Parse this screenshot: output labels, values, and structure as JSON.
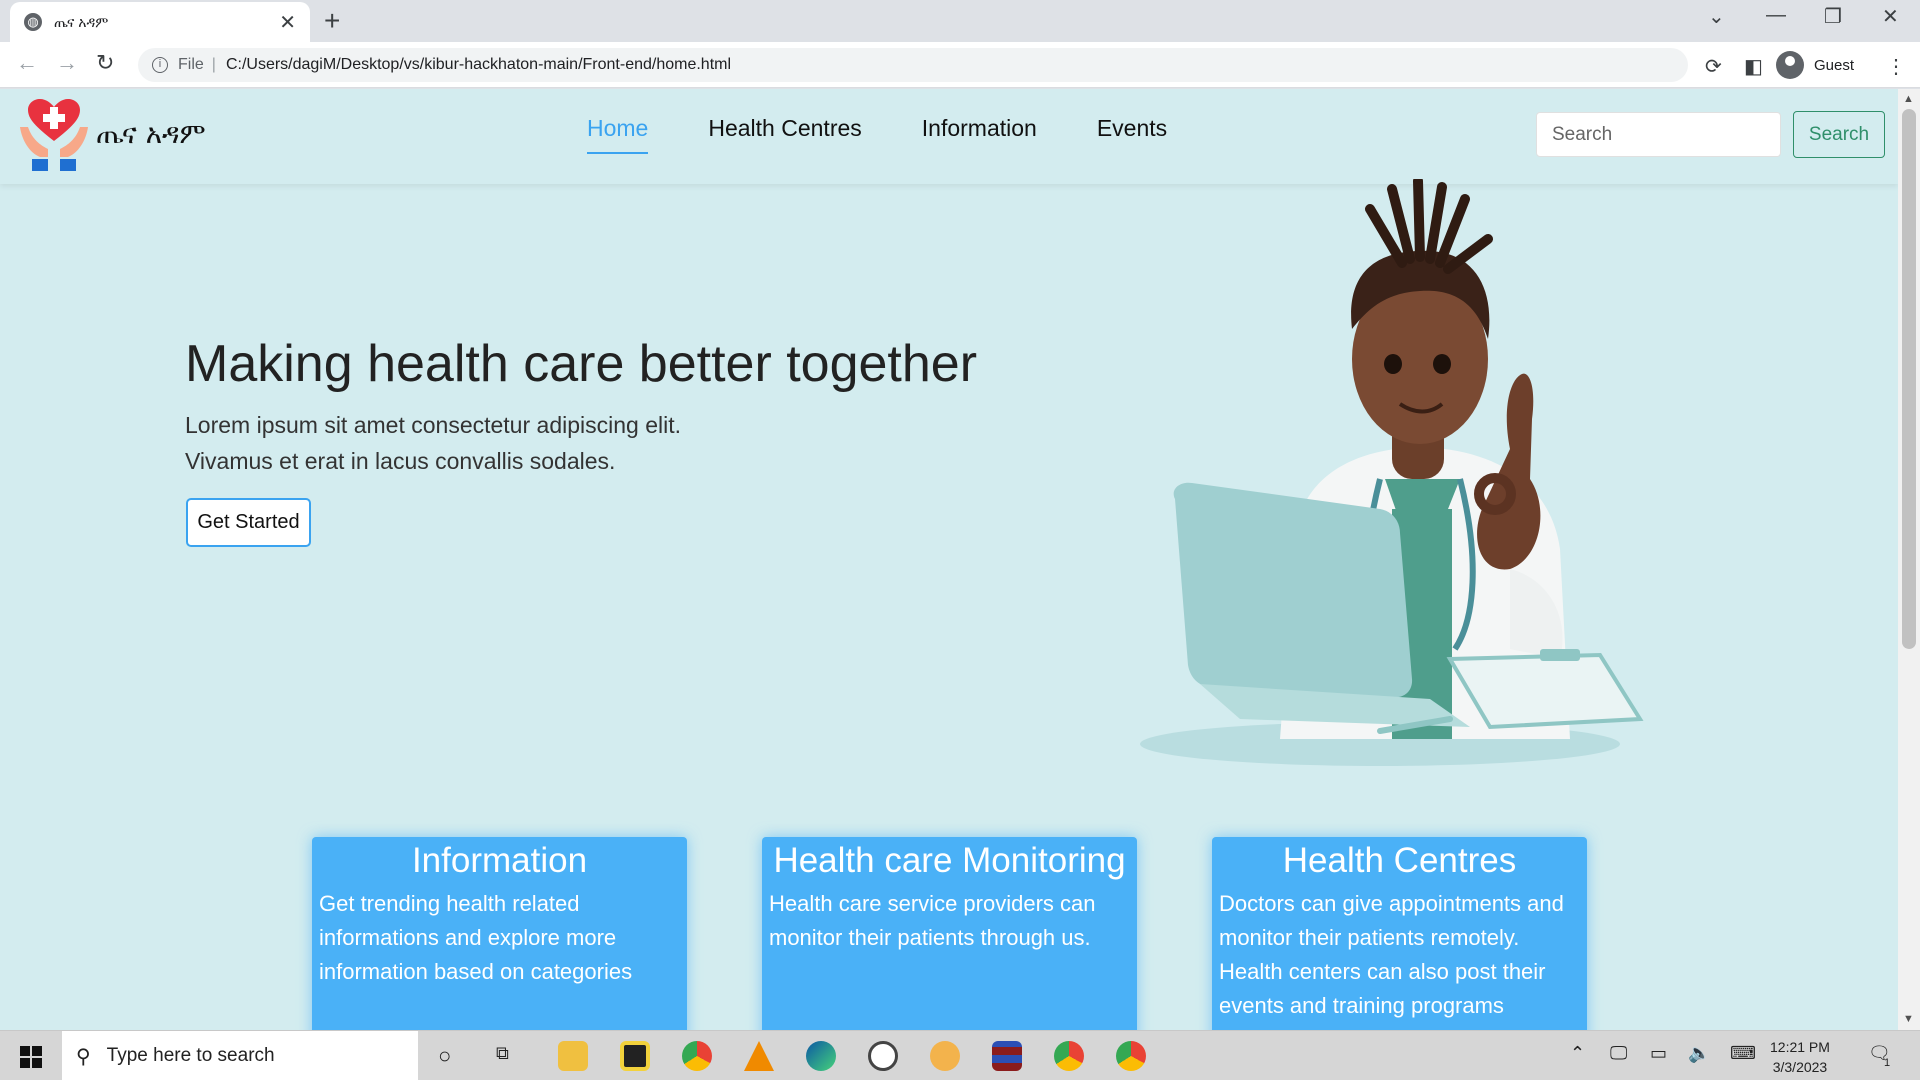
{
  "browser": {
    "tab_title": "ጤና አዳም",
    "address_prefix": "File",
    "url": "C:/Users/dagiM/Desktop/vs/kibur-hackhaton-main/Front-end/home.html",
    "profile_label": "Guest"
  },
  "site": {
    "brand": "ጤና አዳም",
    "nav": [
      "Home",
      "Health Centres",
      "Information",
      "Events"
    ],
    "active_nav": "Home",
    "search_placeholder": "Search",
    "search_button": "Search"
  },
  "hero": {
    "title": "Making health care better together",
    "line1": "Lorem ipsum sit amet consectetur adipiscing elit.",
    "line2": "Vivamus et erat in lacus convallis sodales.",
    "cta": "Get Started"
  },
  "cards": [
    {
      "title": "Information",
      "text": "Get trending health related informations and explore more information based on categories"
    },
    {
      "title": "Health care Monitoring",
      "text": "Health care service providers can monitor their patients through us."
    },
    {
      "title": "Health Centres",
      "text": "Doctors can give appointments and monitor their patients remotely. Health centers can also post their events and training programs"
    }
  ],
  "taskbar": {
    "search_placeholder": "Type here to search",
    "time": "12:21 PM",
    "date": "3/3/2023",
    "notification_count": "1"
  },
  "colors": {
    "page_bg": "#d3ecef",
    "accent": "#3aa3f0",
    "card_bg": "#4ab1f7",
    "search_btn": "#2f8f6a"
  }
}
